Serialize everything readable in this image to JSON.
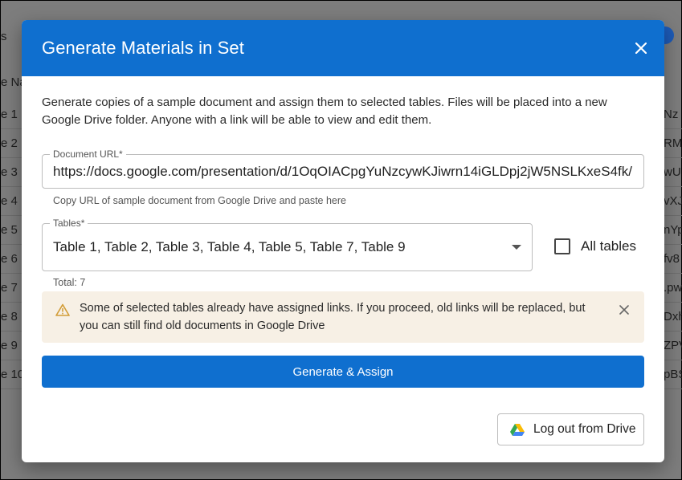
{
  "background": {
    "header_label": "e Na",
    "rows": [
      {
        "left": "e 1",
        "right": "Nz"
      },
      {
        "left": "e 2",
        "right": "RM"
      },
      {
        "left": "e 3",
        "right": "wU"
      },
      {
        "left": "e 4",
        "right": "vXJ"
      },
      {
        "left": "e 5",
        "right": "nYp"
      },
      {
        "left": "e 6",
        "right": "fv8"
      },
      {
        "left": "e 7",
        "right": ".pw"
      },
      {
        "left": "e 8",
        "right": "Dxh"
      },
      {
        "left": "e 9",
        "right": "ZPV"
      },
      {
        "left": "e 10",
        "right": "pBS"
      }
    ],
    "top_left_glyph": "s"
  },
  "dialog": {
    "title": "Generate Materials in Set",
    "intro": "Generate copies of a sample document and assign them to selected tables. Files will be placed into a new Google Drive folder. Anyone with a link will be able to view and edit them.",
    "document_url": {
      "label": "Document URL",
      "required_mark": "*",
      "value": "https://docs.google.com/presentation/d/1OqOIACpgYuNzcywKJiwrn14iGLDpj2jW5NSLKxeS4fk/",
      "helper": "Copy URL of sample document from Google Drive and paste here"
    },
    "tables": {
      "label": "Tables",
      "required_mark": "*",
      "value": "Table 1, Table 2, Table 3, Table 4, Table 5, Table 7, Table 9",
      "helper": "Total: 7"
    },
    "all_tables": {
      "label": "All tables",
      "checked": false
    },
    "alert": {
      "text": "Some of selected tables already have assigned links. If you proceed, old links will be replaced, but you can still find old documents in Google Drive",
      "color": "#f7f0e5",
      "icon": "warning-icon"
    },
    "primary_button": "Generate & Assign",
    "secondary_button": "Log out from Drive",
    "colors": {
      "header": "#0f6fcf",
      "primary": "#0f6fcf",
      "warning": "#d29c36"
    }
  }
}
